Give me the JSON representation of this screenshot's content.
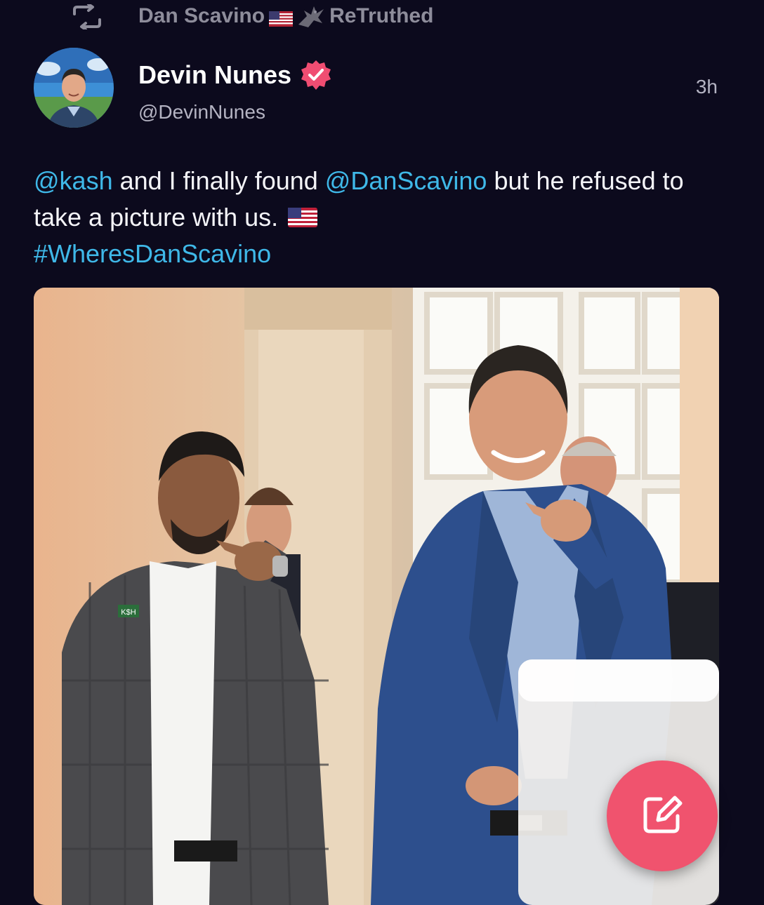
{
  "retruth": {
    "user": "Dan Scavino",
    "action": "ReTruthed",
    "icon": "retruth-icon"
  },
  "author": {
    "display_name": "Devin Nunes",
    "handle": "@DevinNunes",
    "verified": true,
    "time": "3h"
  },
  "post": {
    "mention_1": "@kash",
    "text_1": " and I finally found ",
    "mention_2": "@DanScavino",
    "text_2": " but he refused to take a picture with us. ",
    "hashtag": "#WheresDanScavino"
  },
  "media": {
    "lapel_pin": "K$H"
  },
  "fab": {
    "icon": "compose-icon"
  },
  "colors": {
    "background": "#0c0a1d",
    "link": "#3fb8e8",
    "accent": "#f0536e",
    "muted": "#8e8d9b"
  }
}
